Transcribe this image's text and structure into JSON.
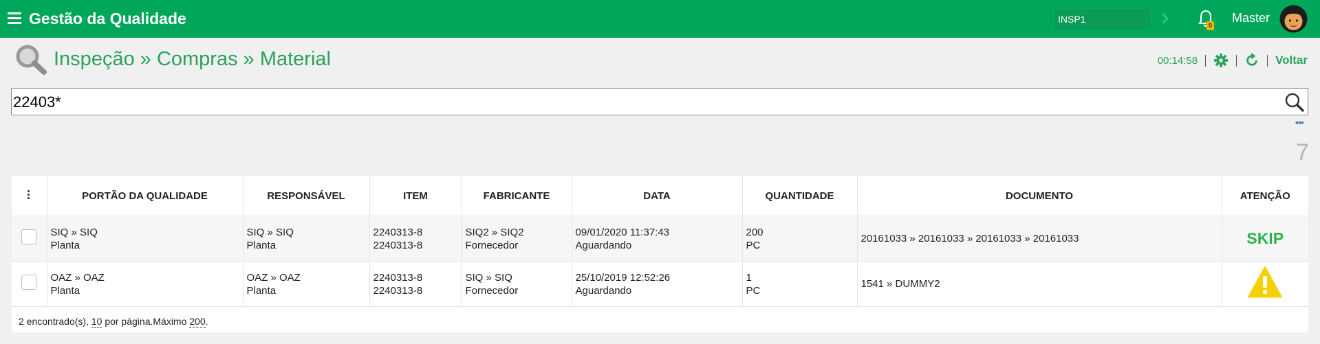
{
  "header": {
    "app_title": "Gestão da Qualidade",
    "inspection_select": "INSP1",
    "notification_count": "0",
    "user_name": "Master"
  },
  "page": {
    "breadcrumb": "Inspeção » Compras » Material",
    "timer": "00:14:58",
    "back_label": "Voltar"
  },
  "search": {
    "value": "22403*"
  },
  "results_count": "7",
  "table": {
    "columns": [
      "PORTÃO DA QUALIDADE",
      "RESPONSÁVEL",
      "ITEM",
      "FABRICANTE",
      "DATA",
      "QUANTIDADE",
      "DOCUMENTO",
      "ATENÇÃO"
    ],
    "rows": [
      {
        "portao": [
          "SIQ » SIQ",
          "Planta"
        ],
        "responsavel": [
          "SIQ » SIQ",
          "Planta"
        ],
        "item": [
          "2240313-8",
          "2240313-8"
        ],
        "fabricante": [
          "SIQ2 » SIQ2",
          "Fornecedor"
        ],
        "data": [
          "09/01/2020 11:37:43",
          "Aguardando"
        ],
        "quantidade": [
          "200",
          "PC"
        ],
        "documento": "20161033 » 20161033 » 20161033 » 20161033",
        "atencao": "SKIP"
      },
      {
        "portao": [
          "OAZ » OAZ",
          "Planta"
        ],
        "responsavel": [
          "OAZ » OAZ",
          "Planta"
        ],
        "item": [
          "2240313-8",
          "2240313-8"
        ],
        "fabricante": [
          "SIQ » SIQ",
          "Fornecedor"
        ],
        "data": [
          "25/10/2019 12:52:26",
          "Aguardando"
        ],
        "quantidade": [
          "1",
          "PC"
        ],
        "documento": "1541 » DUMMY2",
        "atencao": "warning-icon"
      }
    ]
  },
  "footer": {
    "found": "2 encontrado(s),",
    "per_page_value": "10",
    "per_page_label": "por página.Máximo",
    "max_value": "200",
    "end": "."
  },
  "colors": {
    "brand_green": "#00a65a",
    "link_green": "#2aa25a",
    "skip_green": "#2bb24c",
    "warning_yellow": "#f5d000"
  }
}
